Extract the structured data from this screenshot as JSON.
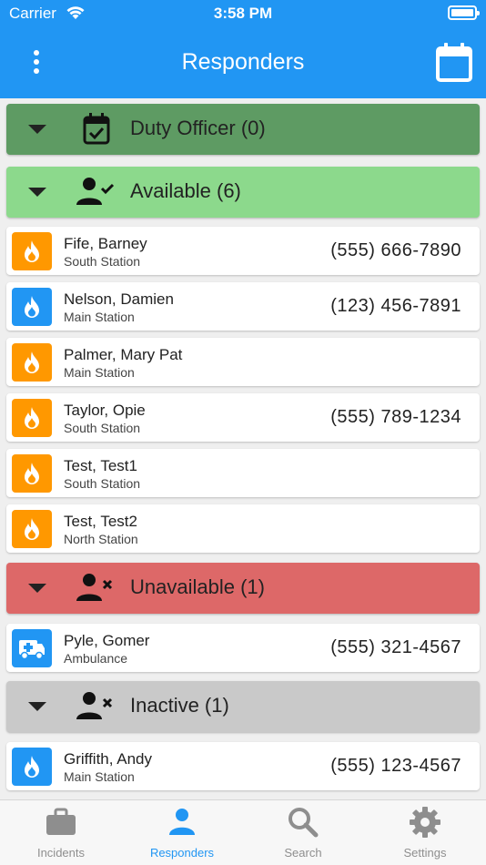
{
  "status_bar": {
    "carrier": "Carrier",
    "time": "3:58 PM"
  },
  "header": {
    "title": "Responders",
    "menu_icon": "more-vertical-icon",
    "calendar_icon": "calendar-icon"
  },
  "groups": {
    "duty": {
      "label": "Duty Officer (0)",
      "color": "#5e9b63",
      "icon": "calendar-check-icon"
    },
    "available": {
      "label": "Available (6)",
      "color": "#8cd98c",
      "icon": "person-check-icon"
    },
    "unavailable": {
      "label": "Unavailable (1)",
      "color": "#dd6868",
      "icon": "person-x-icon"
    },
    "inactive": {
      "label": "Inactive (1)",
      "color": "#c9c9c9",
      "icon": "person-x-icon"
    }
  },
  "responders": [
    {
      "name": "Fife, Barney",
      "station": "South Station",
      "phone": "(555) 666-7890",
      "icon": "fire-icon",
      "color": "#ff9800"
    },
    {
      "name": "Nelson, Damien",
      "station": "Main Station",
      "phone": "(123) 456-7891",
      "icon": "fire-icon",
      "color": "#2196f3"
    },
    {
      "name": "Palmer, Mary Pat",
      "station": "Main Station",
      "phone": "",
      "icon": "fire-icon",
      "color": "#ff9800"
    },
    {
      "name": "Taylor, Opie",
      "station": "South Station",
      "phone": "(555) 789-1234",
      "icon": "fire-icon",
      "color": "#ff9800"
    },
    {
      "name": "Test, Test1",
      "station": "South Station",
      "phone": "",
      "icon": "fire-icon",
      "color": "#ff9800"
    },
    {
      "name": "Test, Test2",
      "station": "North Station",
      "phone": "",
      "icon": "fire-icon",
      "color": "#ff9800"
    },
    {
      "name": "Pyle, Gomer",
      "station": "Ambulance",
      "phone": "(555) 321-4567",
      "icon": "ambulance-icon",
      "color": "#2196f3"
    },
    {
      "name": "Griffith, Andy",
      "station": "Main Station",
      "phone": "(555) 123-4567",
      "icon": "fire-icon",
      "color": "#2196f3"
    }
  ],
  "tabs": [
    {
      "label": "Incidents",
      "icon": "briefcase-icon",
      "active": false
    },
    {
      "label": "Responders",
      "icon": "person-icon",
      "active": true
    },
    {
      "label": "Search",
      "icon": "search-icon",
      "active": false
    },
    {
      "label": "Settings",
      "icon": "gear-icon",
      "active": false
    }
  ],
  "colors": {
    "accent": "#2196f3",
    "fire_orange": "#ff9800",
    "inactive_tab": "#8e8e8e"
  }
}
